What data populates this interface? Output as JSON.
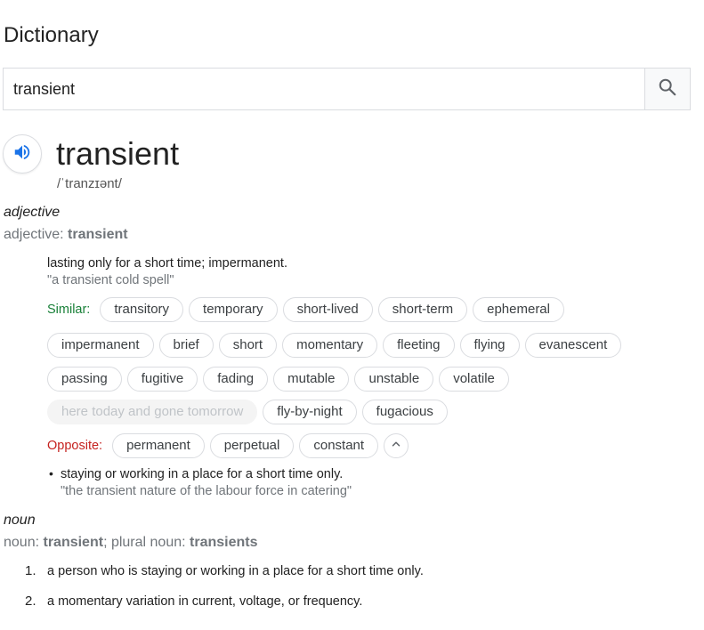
{
  "panel": {
    "title": "Dictionary"
  },
  "search": {
    "value": "transient"
  },
  "entry": {
    "headword": "transient",
    "phonetic": "/ˈtranzɪənt/"
  },
  "adjective": {
    "pos": "adjective",
    "form_prefix": "adjective: ",
    "form_word": "transient",
    "sense": {
      "definition": "lasting only for a short time; impermanent.",
      "example": "\"a transient cold spell\"",
      "similar_label": "Similar:",
      "similar_row1": [
        "transitory",
        "temporary",
        "short-lived",
        "short-term",
        "ephemeral"
      ],
      "similar_row2": [
        "impermanent",
        "brief",
        "short",
        "momentary",
        "fleeting",
        "flying",
        "evanescent"
      ],
      "similar_row3": [
        "passing",
        "fugitive",
        "fading",
        "mutable",
        "unstable",
        "volatile"
      ],
      "similar_row4_faded": "here today and gone tomorrow",
      "similar_row4": [
        "fly-by-night",
        "fugacious"
      ],
      "opposite_label": "Opposite:",
      "opposites": [
        "permanent",
        "perpetual",
        "constant"
      ]
    },
    "sense2": {
      "bullet": "•",
      "definition": "staying or working in a place for a short time only.",
      "example": "\"the transient nature of the labour force in catering\""
    }
  },
  "noun": {
    "pos": "noun",
    "form_prefix": "noun: ",
    "form_word": "transient",
    "plural_prefix": "; plural noun: ",
    "plural_word": "transients",
    "senses": [
      {
        "num": "1.",
        "definition": "a person who is staying or working in a place for a short time only."
      },
      {
        "num": "2.",
        "definition": "a momentary variation in current, voltage, or frequency."
      }
    ]
  },
  "icons": {
    "search": "search-icon",
    "speaker": "speaker-icon",
    "toggle": "chevron-up-icon"
  },
  "colors": {
    "similar": "#188038",
    "opposite": "#c5221f",
    "speaker": "#1a73e8"
  }
}
